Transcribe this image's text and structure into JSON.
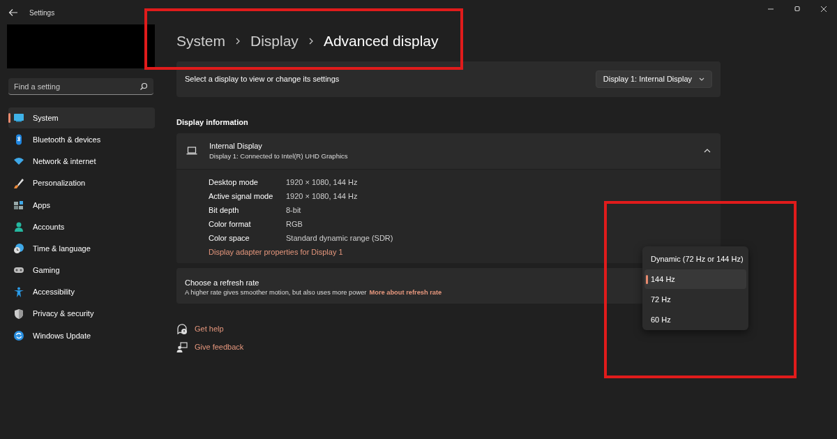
{
  "window": {
    "title": "Settings"
  },
  "search": {
    "placeholder": "Find a setting"
  },
  "sidebar": {
    "items": [
      {
        "label": "System",
        "selected": true
      },
      {
        "label": "Bluetooth & devices",
        "selected": false
      },
      {
        "label": "Network & internet",
        "selected": false
      },
      {
        "label": "Personalization",
        "selected": false
      },
      {
        "label": "Apps",
        "selected": false
      },
      {
        "label": "Accounts",
        "selected": false
      },
      {
        "label": "Time & language",
        "selected": false
      },
      {
        "label": "Gaming",
        "selected": false
      },
      {
        "label": "Accessibility",
        "selected": false
      },
      {
        "label": "Privacy & security",
        "selected": false
      },
      {
        "label": "Windows Update",
        "selected": false
      }
    ]
  },
  "breadcrumb": {
    "highlighted": true,
    "items": [
      "System",
      "Display",
      "Advanced display"
    ]
  },
  "display_select": {
    "label": "Select a display to view or change its settings",
    "value": "Display 1: Internal Display"
  },
  "display_information": {
    "heading": "Display information",
    "name": "Internal Display",
    "subtitle": "Display 1: Connected to Intel(R) UHD Graphics",
    "expanded": true,
    "rows": [
      {
        "label": "Desktop mode",
        "value": "1920 × 1080, 144 Hz"
      },
      {
        "label": "Active signal mode",
        "value": "1920 × 1080, 144 Hz"
      },
      {
        "label": "Bit depth",
        "value": "8-bit"
      },
      {
        "label": "Color format",
        "value": "RGB"
      },
      {
        "label": "Color space",
        "value": "Standard dynamic range (SDR)"
      }
    ],
    "link": "Display adapter properties for Display 1"
  },
  "refresh_rate": {
    "title": "Choose a refresh rate",
    "description": "A higher rate gives smoother motion, but also uses more power",
    "link": "More about refresh rate",
    "menu": {
      "highlighted": true,
      "options": [
        {
          "label": "Dynamic (72 Hz or 144 Hz)",
          "selected": false
        },
        {
          "label": "144 Hz",
          "selected": true
        },
        {
          "label": "72 Hz",
          "selected": false
        },
        {
          "label": "60 Hz",
          "selected": false
        }
      ]
    }
  },
  "help_links": [
    {
      "label": "Get help"
    },
    {
      "label": "Give feedback"
    }
  ]
}
